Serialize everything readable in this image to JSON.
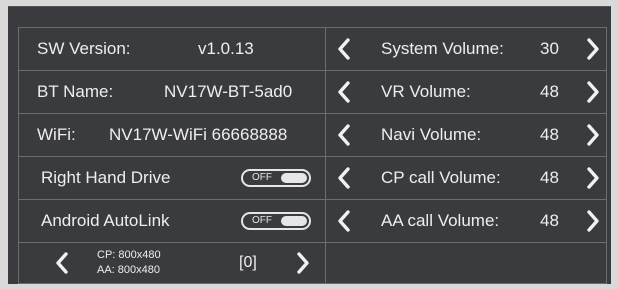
{
  "left": {
    "sw_version": {
      "label": "SW Version:",
      "value": "v1.0.13"
    },
    "bt_name": {
      "label": "BT Name:",
      "value": "NV17W-BT-5ad0"
    },
    "wifi": {
      "label": "WiFi:",
      "value": "NV17W-WiFi 66668888"
    },
    "right_hand_drive": {
      "label": "Right Hand Drive",
      "toggle": "OFF"
    },
    "android_autolink": {
      "label": "Android AutoLink",
      "toggle": "OFF"
    },
    "resolution": {
      "cp": "CP: 800x480",
      "aa": "AA: 800x480",
      "index": "[0]"
    }
  },
  "right": {
    "volumes": [
      {
        "label": "System Volume:",
        "value": "30"
      },
      {
        "label": "VR Volume:",
        "value": "48"
      },
      {
        "label": "Navi Volume:",
        "value": "48"
      },
      {
        "label": "CP call Volume:",
        "value": "48"
      },
      {
        "label": "AA call Volume:",
        "value": "48"
      }
    ]
  },
  "icons": {
    "prev": "chevron-left-icon",
    "next": "chevron-right-icon"
  },
  "colors": {
    "background": "#3a3b3e",
    "text": "#eeeeee",
    "grid_line": "#6c6d70"
  }
}
